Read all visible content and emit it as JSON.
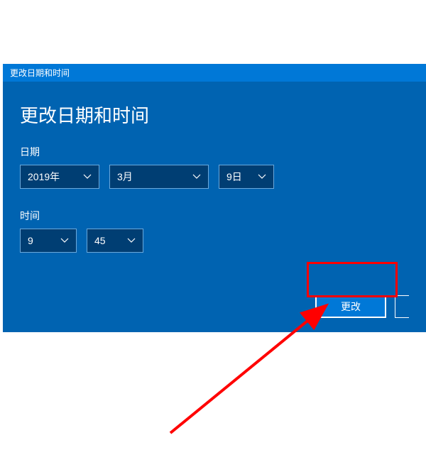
{
  "titleBar": "更改日期和时间",
  "heading": "更改日期和时间",
  "dateLabel": "日期",
  "timeLabel": "时间",
  "date": {
    "year": "2019年",
    "month": "3月",
    "day": "9日"
  },
  "time": {
    "hour": "9",
    "minute": "45"
  },
  "buttons": {
    "change": "更改"
  }
}
